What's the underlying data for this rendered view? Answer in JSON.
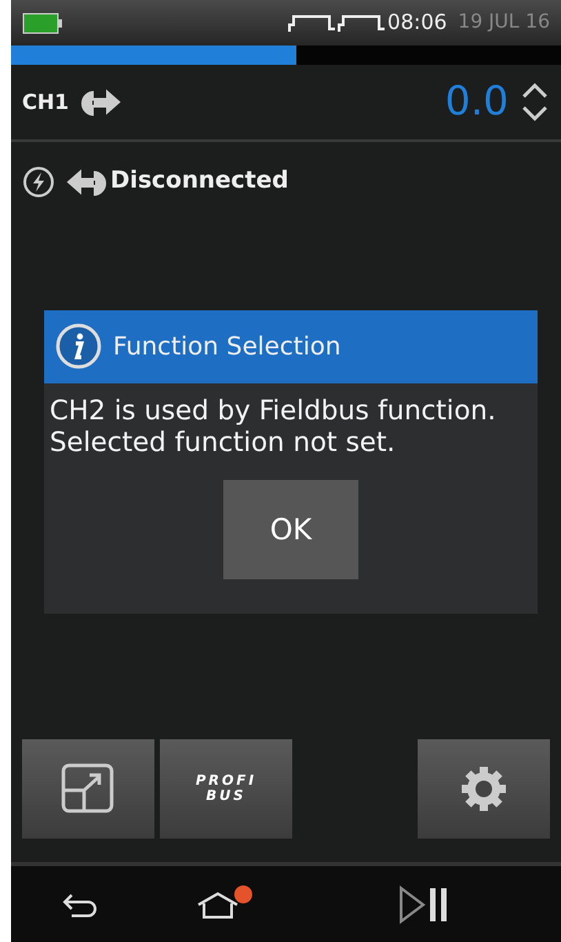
{
  "status_bar": {
    "time": "08:06",
    "date": "19 JUL 16"
  },
  "progress": {
    "level": 0.52
  },
  "channel": {
    "label": "CH1",
    "value": "0.0"
  },
  "connection": {
    "status": "Disconnected"
  },
  "dialog": {
    "title": "Function Selection",
    "message": "CH2 is used by Fieldbus function. Selected function not set.",
    "button": "OK"
  },
  "toolbar": {
    "logo_top": "PROFI",
    "logo_bottom": "BUS"
  },
  "nav": {
    "home_notification": true
  }
}
